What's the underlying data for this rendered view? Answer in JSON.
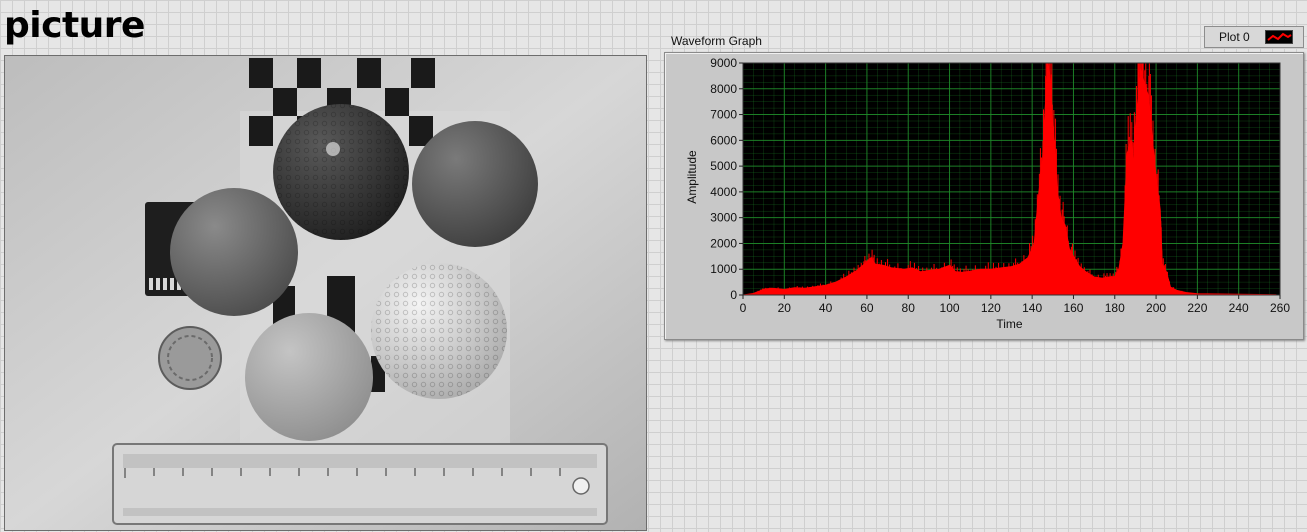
{
  "page": {
    "title": "picture"
  },
  "graph": {
    "label": "Waveform Graph",
    "legend": {
      "label": "Plot 0",
      "color": "#ff0000"
    },
    "plot_bg": "#000000",
    "grid_color": "#1f8c2a"
  },
  "chart_data": {
    "type": "area",
    "xlabel": "Time",
    "ylabel": "Amplitude",
    "xlim": [
      0,
      260
    ],
    "ylim": [
      0,
      9000
    ],
    "x_ticks": [
      "0",
      "20",
      "40",
      "60",
      "80",
      "100",
      "120",
      "140",
      "160",
      "180",
      "200",
      "220",
      "240",
      "260"
    ],
    "y_ticks": [
      "0",
      "1000",
      "2000",
      "3000",
      "4000",
      "5000",
      "6000",
      "7000",
      "8000",
      "9000"
    ],
    "grid": true,
    "series": [
      {
        "name": "Plot 0",
        "color": "#ff0000",
        "points": [
          [
            0,
            0
          ],
          [
            5,
            60
          ],
          [
            8,
            150
          ],
          [
            10,
            230
          ],
          [
            14,
            260
          ],
          [
            20,
            220
          ],
          [
            25,
            280
          ],
          [
            30,
            260
          ],
          [
            35,
            320
          ],
          [
            40,
            380
          ],
          [
            45,
            500
          ],
          [
            50,
            700
          ],
          [
            55,
            950
          ],
          [
            58,
            1150
          ],
          [
            60,
            1300
          ],
          [
            62,
            1450
          ],
          [
            64,
            1200
          ],
          [
            68,
            1150
          ],
          [
            72,
            1050
          ],
          [
            78,
            1000
          ],
          [
            82,
            1050
          ],
          [
            86,
            900
          ],
          [
            90,
            950
          ],
          [
            95,
            1000
          ],
          [
            100,
            1150
          ],
          [
            103,
            900
          ],
          [
            106,
            880
          ],
          [
            110,
            920
          ],
          [
            115,
            1000
          ],
          [
            120,
            1000
          ],
          [
            125,
            1050
          ],
          [
            130,
            1100
          ],
          [
            134,
            1200
          ],
          [
            138,
            1450
          ],
          [
            141,
            2000
          ],
          [
            143,
            3800
          ],
          [
            145,
            5200
          ],
          [
            146,
            6800
          ],
          [
            147,
            8200
          ],
          [
            148,
            8900
          ],
          [
            149,
            8200
          ],
          [
            150,
            6500
          ],
          [
            151,
            5800
          ],
          [
            152,
            4200
          ],
          [
            154,
            3000
          ],
          [
            156,
            2700
          ],
          [
            158,
            1800
          ],
          [
            160,
            1500
          ],
          [
            163,
            1100
          ],
          [
            166,
            900
          ],
          [
            170,
            700
          ],
          [
            174,
            650
          ],
          [
            177,
            700
          ],
          [
            180,
            720
          ],
          [
            182,
            1000
          ],
          [
            184,
            2000
          ],
          [
            186,
            5500
          ],
          [
            188,
            6000
          ],
          [
            189,
            5000
          ],
          [
            190,
            6500
          ],
          [
            191,
            7400
          ],
          [
            192,
            8300
          ],
          [
            193,
            8700
          ],
          [
            194,
            8300
          ],
          [
            196,
            7800
          ],
          [
            197,
            7200
          ],
          [
            198,
            6200
          ],
          [
            200,
            4600
          ],
          [
            202,
            3300
          ],
          [
            203,
            1200
          ],
          [
            205,
            900
          ],
          [
            207,
            300
          ],
          [
            210,
            180
          ],
          [
            215,
            90
          ],
          [
            220,
            50
          ],
          [
            230,
            40
          ],
          [
            240,
            30
          ],
          [
            250,
            20
          ],
          [
            258,
            10
          ]
        ]
      }
    ]
  }
}
